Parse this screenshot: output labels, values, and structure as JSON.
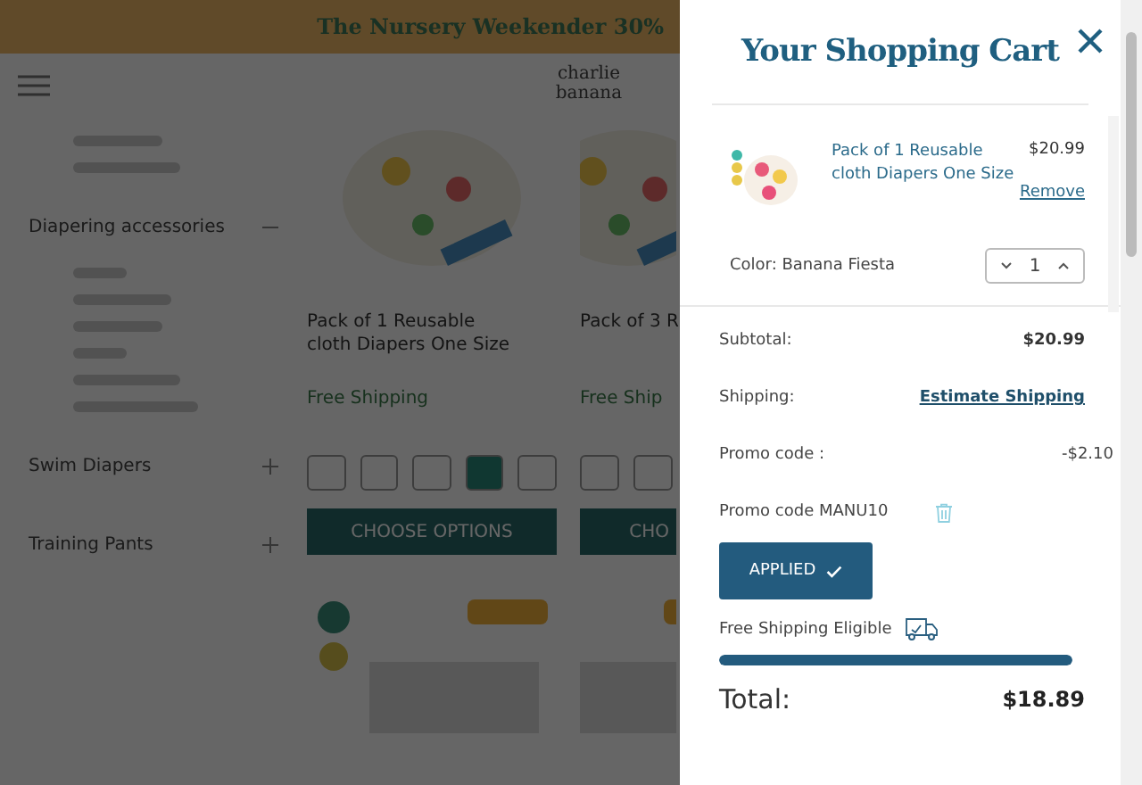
{
  "banner": {
    "text": "The Nursery Weekender 30%"
  },
  "header": {
    "logo": "charlie banana"
  },
  "sidebar": {
    "groups": [
      {
        "label": "Diapering accessories",
        "expanded": true
      },
      {
        "label": "Swim Diapers",
        "expanded": false
      },
      {
        "label": "Training Pants",
        "expanded": false
      }
    ]
  },
  "products": [
    {
      "title": "Pack of 1 Reusable cloth Diapers One Size",
      "shipping": "Free Shipping",
      "button": "CHOOSE OPTIONS"
    },
    {
      "title": "Pack of 3 R",
      "shipping": "Free Ship",
      "button": "CHO"
    }
  ],
  "cart": {
    "title": "Your Shopping Cart",
    "item": {
      "name": "Pack of 1 Reusable cloth Diapers One Size",
      "price": "$20.99",
      "remove": "Remove",
      "variant": "Color: Banana Fiesta",
      "quantity": "1"
    },
    "subtotal": {
      "label": "Subtotal:",
      "value": "$20.99"
    },
    "shipping": {
      "label": "Shipping:",
      "link": "Estimate Shipping"
    },
    "promo": {
      "label": "Promo code :",
      "value": "-$2.10"
    },
    "promo_code": {
      "label": "Promo code MANU10"
    },
    "applied_button": "APPLIED",
    "free_shipping": {
      "label": "Free Shipping Eligible",
      "level": 1
    },
    "total": {
      "label": "Total:",
      "value": "$18.89"
    }
  }
}
